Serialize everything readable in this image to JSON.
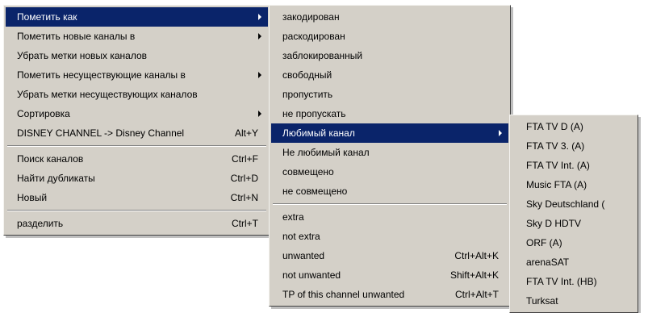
{
  "main_menu": {
    "items": [
      {
        "label": "Пометить как",
        "has_submenu": true,
        "highlighted": true
      },
      {
        "label": "Пометить новые каналы в",
        "has_submenu": true
      },
      {
        "label": "Убрать метки новых каналов"
      },
      {
        "label": "Пометить несуществующие каналы в",
        "has_submenu": true
      },
      {
        "label": "Убрать метки несуществующих каналов"
      },
      {
        "label": "Сортировка",
        "has_submenu": true
      },
      {
        "label": "DISNEY CHANNEL -> Disney Channel",
        "shortcut": "Alt+Y"
      },
      {
        "label": "Поиск каналов",
        "shortcut": "Ctrl+F"
      },
      {
        "label": "Найти дубликаты",
        "shortcut": "Ctrl+D"
      },
      {
        "label": "Новый",
        "shortcut": "Ctrl+N"
      },
      {
        "label": "разделить",
        "shortcut": "Ctrl+T"
      }
    ]
  },
  "mark_as_submenu": {
    "items": [
      {
        "label": "закодирован"
      },
      {
        "label": "раскодирован"
      },
      {
        "label": "заблокированный"
      },
      {
        "label": "свободный"
      },
      {
        "label": "пропустить"
      },
      {
        "label": "не пропускать"
      },
      {
        "label": "Любимый канал",
        "has_submenu": true,
        "highlighted": true
      },
      {
        "label": "Не любимый канал"
      },
      {
        "label": "совмещено"
      },
      {
        "label": "не совмещено"
      },
      {
        "label": "extra"
      },
      {
        "label": "not extra"
      },
      {
        "label": "unwanted",
        "shortcut": "Ctrl+Alt+K"
      },
      {
        "label": "not unwanted",
        "shortcut": "Shift+Alt+K"
      },
      {
        "label": "TP of this channel unwanted",
        "shortcut": "Ctrl+Alt+T"
      }
    ]
  },
  "favorites_submenu": {
    "items": [
      {
        "label": "FTA TV D (A)"
      },
      {
        "label": "FTA TV 3. (A)"
      },
      {
        "label": "FTA TV Int. (A)"
      },
      {
        "label": "Music FTA (A)"
      },
      {
        "label": "Sky Deutschland ("
      },
      {
        "label": "Sky D HDTV"
      },
      {
        "label": "ORF (A)"
      },
      {
        "label": "arenaSAT"
      },
      {
        "label": "FTA TV Int. (HB)"
      },
      {
        "label": "Turksat"
      }
    ]
  },
  "colors": {
    "menu_bg": "#d4d0c8",
    "highlight_bg": "#0a246a",
    "highlight_fg": "#ffffff"
  }
}
